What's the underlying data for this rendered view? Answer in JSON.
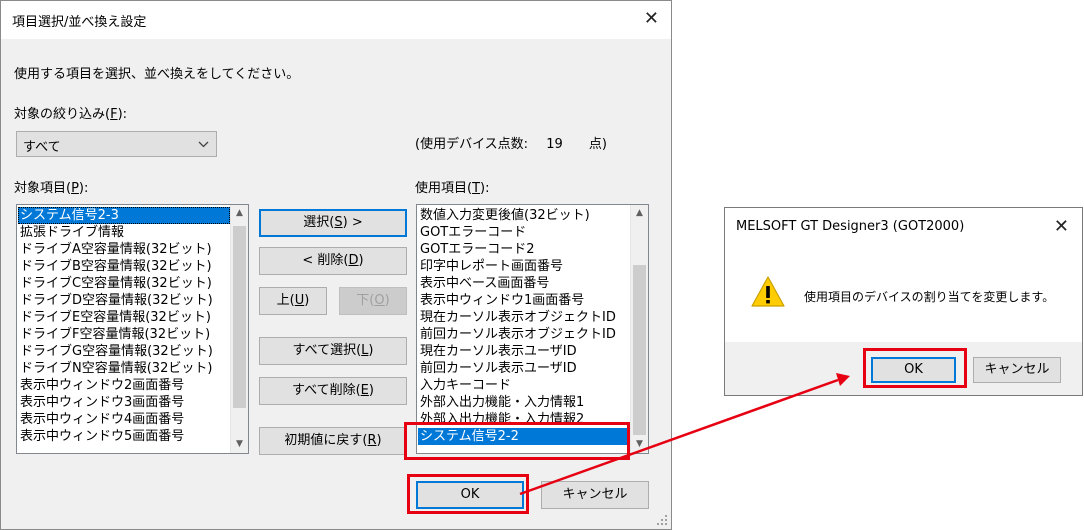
{
  "dialog": {
    "title": "項目選択/並べ換え設定",
    "instruction": "使用する項目を選択、並べ換えをしてください。",
    "filter_label": "対象の絞り込み(",
    "filter_key": "F",
    "filter_suffix": "):",
    "filter_value": "すべて",
    "device_count_label": "(使用デバイス点数:",
    "device_count_value": "19",
    "device_count_unit": "点)",
    "target_label": "対象項目(",
    "target_key": "P",
    "target_suffix": "):",
    "target_items": [
      "システム信号2-3",
      "拡張ドライブ情報",
      "ドライブA空容量情報(32ビット)",
      "ドライブB空容量情報(32ビット)",
      "ドライブC空容量情報(32ビット)",
      "ドライブD空容量情報(32ビット)",
      "ドライブE空容量情報(32ビット)",
      "ドライブF空容量情報(32ビット)",
      "ドライブG空容量情報(32ビット)",
      "ドライブN空容量情報(32ビット)",
      "表示中ウィンドウ2画面番号",
      "表示中ウィンドウ3画面番号",
      "表示中ウィンドウ4画面番号",
      "表示中ウィンドウ5画面番号"
    ],
    "used_label": "使用項目(",
    "used_key": "T",
    "used_suffix": "):",
    "used_items": [
      "数値入力変更後値(32ビット)",
      "GOTエラーコード",
      "GOTエラーコード2",
      "印字中レポート画面番号",
      "表示中ベース画面番号",
      "表示中ウィンドウ1画面番号",
      "現在カーソル表示オブジェクトID",
      "前回カーソル表示オブジェクトID",
      "現在カーソル表示ユーザID",
      "前回カーソル表示ユーザID",
      "入力キーコード",
      "外部入出力機能・入力情報1",
      "外部入出力機能・入力情報2",
      "システム信号2-2"
    ],
    "buttons": {
      "select": "選択(",
      "select_key": "S",
      "select_suffix": ") >",
      "delete": "< 削除(",
      "delete_key": "D",
      "delete_suffix": ")",
      "up": "上(",
      "up_key": "U",
      "up_suffix": ")",
      "down": "下(",
      "down_key": "O",
      "down_suffix": ")",
      "select_all": "すべて選択(",
      "select_all_key": "L",
      "select_all_suffix": ")",
      "delete_all": "すべて削除(",
      "delete_all_key": "E",
      "delete_all_suffix": ")",
      "reset": "初期値に戻す(",
      "reset_key": "R",
      "reset_suffix": ")",
      "ok": "OK",
      "cancel": "キャンセル"
    }
  },
  "message_box": {
    "title": "MELSOFT GT Designer3 (GOT2000)",
    "message": "使用項目のデバイスの割り当てを変更します。",
    "ok": "OK",
    "cancel": "キャンセル",
    "icon": "warning-icon"
  },
  "annotation_color": "#e60012"
}
